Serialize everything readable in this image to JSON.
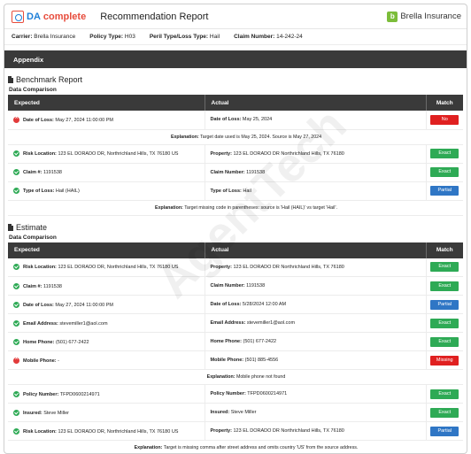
{
  "header": {
    "logo_text_a": "DA",
    "logo_text_b": "complete",
    "title": "Recommendation Report",
    "brand": "Brella Insurance"
  },
  "meta": {
    "carrier_label": "Carrier:",
    "carrier_value": "Brella Insurance",
    "policy_type_label": "Policy Type:",
    "policy_type_value": "H03",
    "peril_label": "Peril Type/Loss Type:",
    "peril_value": "Hail",
    "claim_label": "Claim Number:",
    "claim_value": "14-242-24"
  },
  "appendix": "Appendix",
  "columns": {
    "expected": "Expected",
    "actual": "Actual",
    "match": "Match"
  },
  "benchmark": {
    "title": "Benchmark Report",
    "subtitle": "Data Comparison",
    "rows": [
      {
        "status": "bad",
        "exp_label": "Date of Loss:",
        "exp_value": "May 27, 2024 11:00:00 PM",
        "act_label": "Date of Loss:",
        "act_value": "May 25, 2024",
        "match": "No",
        "match_kind": "no",
        "explanation": "Target date used is May 25, 2024. Source is May 27, 2024"
      },
      {
        "status": "ok",
        "exp_label": "Risk Location:",
        "exp_value": "123 EL DORADO DR, Northrichland Hills, TX 76180 US",
        "act_label": "Property:",
        "act_value": "123 EL DORADO DR Northrichland Hills, TX 76180",
        "match": "Exact",
        "match_kind": "exact"
      },
      {
        "status": "ok",
        "exp_label": "Claim #:",
        "exp_value": "1191538",
        "act_label": "Claim Number:",
        "act_value": "1191538",
        "match": "Exact",
        "match_kind": "exact"
      },
      {
        "status": "ok",
        "exp_label": "Type of Loss:",
        "exp_value": "Hail (HAIL)",
        "act_label": "Type of Loss:",
        "act_value": "Hail",
        "match": "Partial",
        "match_kind": "partial",
        "explanation": "Target missing code in parentheses: source is 'Hail (HAIL)' vs target 'Hail'."
      }
    ]
  },
  "estimate": {
    "title": "Estimate",
    "subtitle": "Data Comparison",
    "rows": [
      {
        "status": "ok",
        "exp_label": "Risk Location:",
        "exp_value": "123 EL DORADO DR, Northrichland Hills, TX 76180 US",
        "act_label": "Property:",
        "act_value": "123 EL DORADO DR Northrichland Hills, TX 76180",
        "match": "Exact",
        "match_kind": "exact"
      },
      {
        "status": "ok",
        "exp_label": "Claim #:",
        "exp_value": "1191538",
        "act_label": "Claim Number:",
        "act_value": "1191538",
        "match": "Exact",
        "match_kind": "exact"
      },
      {
        "status": "ok",
        "exp_label": "Date of Loss:",
        "exp_value": "May 27, 2024 11:00:00 PM",
        "act_label": "Date of Loss:",
        "act_value": "5/28/2024 12:00 AM",
        "match": "Partial",
        "match_kind": "partial"
      },
      {
        "status": "ok",
        "exp_label": "Email Address:",
        "exp_value": "stevemiller1@aol.com",
        "act_label": "Email Address:",
        "act_value": "stevemiller1@aol.com",
        "match": "Exact",
        "match_kind": "exact"
      },
      {
        "status": "ok",
        "exp_label": "Home Phone:",
        "exp_value": "(501) 677-2422",
        "act_label": "Home Phone:",
        "act_value": "(501) 677-2422",
        "match": "Exact",
        "match_kind": "exact"
      },
      {
        "status": "bad",
        "exp_label": "Mobile Phone:",
        "exp_value": "-",
        "act_label": "Mobile Phone:",
        "act_value": "(501) 885-4556",
        "match": "Missing",
        "match_kind": "missing",
        "explanation": "Mobile phone not found"
      },
      {
        "status": "ok",
        "exp_label": "Policy Number:",
        "exp_value": "TFPD0600214971",
        "act_label": "Policy Number:",
        "act_value": "TFPD0600214971",
        "match": "Exact",
        "match_kind": "exact"
      },
      {
        "status": "ok",
        "exp_label": "Insured:",
        "exp_value": "Steve Miller",
        "act_label": "Insured:",
        "act_value": "Steve Miller",
        "match": "Exact",
        "match_kind": "exact"
      },
      {
        "status": "ok",
        "exp_label": "Risk Location:",
        "exp_value": "123 EL DORADO DR, Northrichland Hills, TX 76180 US",
        "act_label": "Property:",
        "act_value": "123 EL DORADO DR Northrichland Hills, TX 76180",
        "match": "Partial",
        "match_kind": "partial",
        "explanation": "Target is missing comma after street address and omits country 'US' from the source address."
      }
    ]
  },
  "explanation_label": "Explanation:",
  "watermark": "AgentTech"
}
